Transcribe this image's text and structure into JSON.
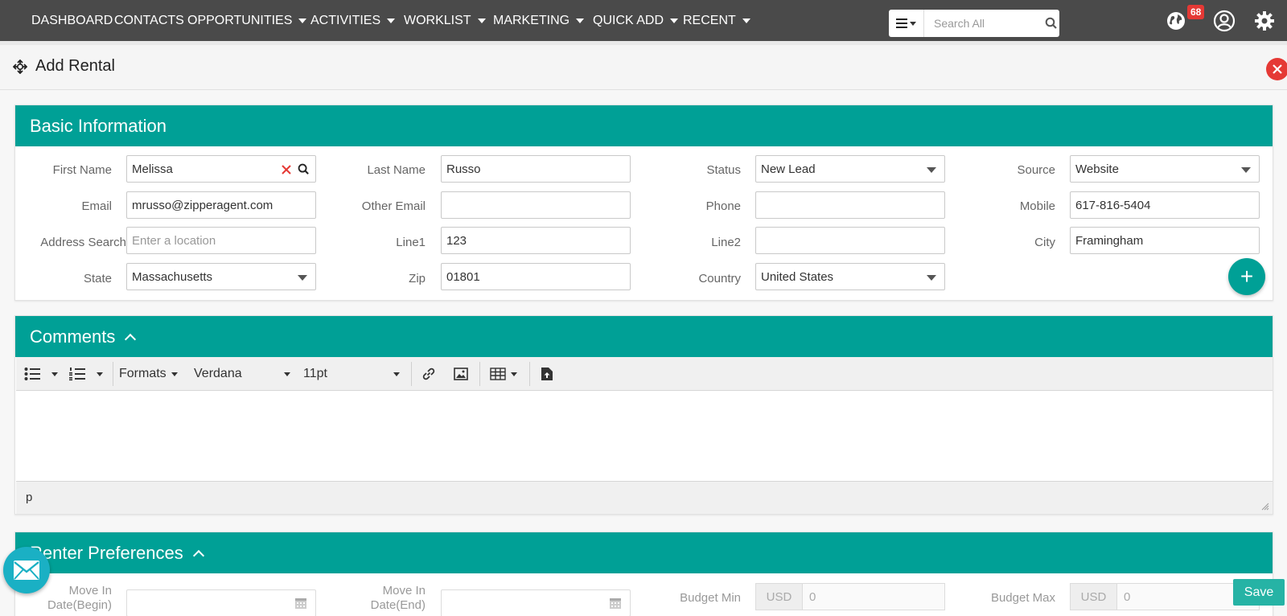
{
  "nav": {
    "items": [
      {
        "label": "DASHBOARD",
        "caret": false
      },
      {
        "label": "CONTACTS",
        "caret": false
      },
      {
        "label": "OPPORTUNITIES",
        "caret": true
      },
      {
        "label": "ACTIVITIES",
        "caret": true
      },
      {
        "label": "WORKLIST",
        "caret": true
      },
      {
        "label": "MARKETING",
        "caret": true
      },
      {
        "label": "QUICK ADD",
        "caret": true
      },
      {
        "label": "RECENT",
        "caret": true
      }
    ],
    "search_placeholder": "Search All",
    "notification_count": "68"
  },
  "page": {
    "title": "Add Rental"
  },
  "basic": {
    "title": "Basic Information",
    "first_name_label": "First Name",
    "first_name": "Melissa",
    "last_name_label": "Last Name",
    "last_name": "Russo",
    "status_label": "Status",
    "status": "New Lead",
    "source_label": "Source",
    "source": "Website",
    "email_label": "Email",
    "email": "mrusso@zipperagent.com",
    "other_email_label": "Other Email",
    "other_email": "",
    "phone_label": "Phone",
    "phone": "",
    "mobile_label": "Mobile",
    "mobile": "617-816-5404",
    "address_search_label": "Address Search",
    "address_search_placeholder": "Enter a location",
    "line1_label": "Line1",
    "line1": "123",
    "line2_label": "Line2",
    "line2": "",
    "city_label": "City",
    "city": "Framingham",
    "state_label": "State",
    "state": "Massachusetts",
    "zip_label": "Zip",
    "zip": "01801",
    "country_label": "Country",
    "country": "United States",
    "add_label": "+"
  },
  "comments": {
    "title": "Comments",
    "formats_label": "Formats",
    "font": "Verdana",
    "size": "11pt",
    "path": "p"
  },
  "renter": {
    "title": "Renter Preferences",
    "move_in_begin_label_1": "Move In",
    "move_in_begin_label_2": "Date(Begin)",
    "move_in_end_label_1": "Move In",
    "move_in_end_label_2": "Date(End)",
    "budget_min_label": "Budget Min",
    "budget_min_currency": "USD",
    "budget_min": "0",
    "budget_max_label": "Budget Max",
    "budget_max_currency": "USD",
    "budget_max": "0"
  },
  "actions": {
    "save_label": "Save"
  }
}
